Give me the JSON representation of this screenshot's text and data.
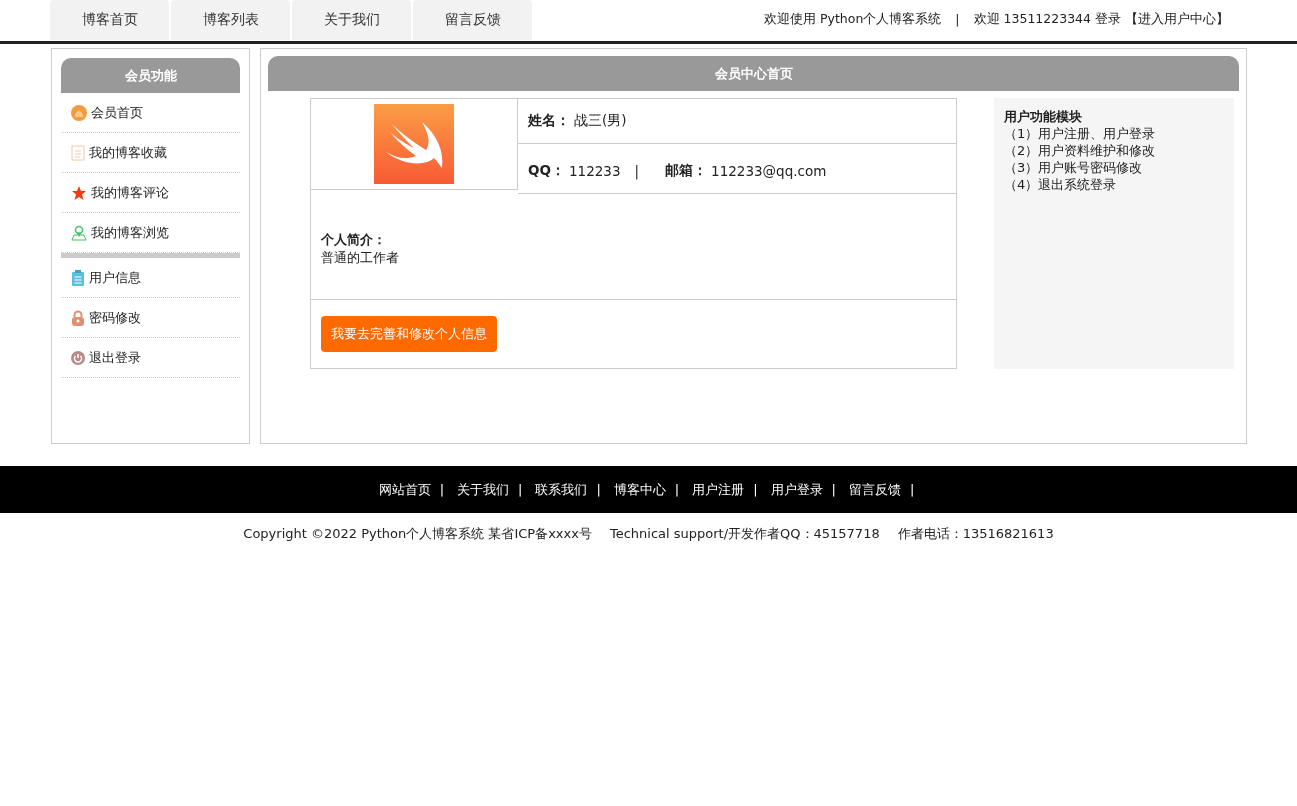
{
  "nav": {
    "tabs": [
      {
        "label": "博客首页"
      },
      {
        "label": "博客列表"
      },
      {
        "label": "关于我们"
      },
      {
        "label": "留言反馈"
      }
    ],
    "welcome": "欢迎使用 Python个人博客系统",
    "separator": "|",
    "user": "欢迎 13511223344 登录",
    "center_link": "【进入用户中心】"
  },
  "sidebar": {
    "title": "会员功能",
    "groups": [
      [
        {
          "label": "会员首页",
          "kind": "home"
        },
        {
          "label": "我的博客收藏",
          "kind": "doc"
        },
        {
          "label": "我的博客评论",
          "kind": "star"
        },
        {
          "label": "我的博客浏览",
          "kind": "pin"
        }
      ],
      [
        {
          "label": "用户信息",
          "kind": "clipboard"
        },
        {
          "label": "密码修改",
          "kind": "lock"
        },
        {
          "label": "退出登录",
          "kind": "power"
        }
      ]
    ]
  },
  "main": {
    "title": "会员中心首页",
    "profile": {
      "name_label": "姓名：",
      "name": "战三(男)",
      "qq_label": "QQ：",
      "qq": "112233",
      "separator": "|",
      "email_label": "邮箱：",
      "email": "112233@qq.com",
      "intro_label": "个人简介：",
      "intro": "普通的工作者",
      "edit_button": "我要去完善和修改个人信息"
    },
    "module": {
      "title": "用户功能模块",
      "items": [
        "（1）用户注册、用户登录",
        "（2）用户资料维护和修改",
        "（3）用户账号密码修改",
        "（4）退出系统登录"
      ]
    }
  },
  "footer": {
    "links": [
      "网站首页",
      "关于我们",
      "联系我们",
      "博客中心",
      "用户注册",
      "用户登录",
      "留言反馈"
    ],
    "separator": "|",
    "copyright": "Copyright ©2022 Python个人博客系统 某省ICP备xxxx号",
    "support": "Technical support/开发作者QQ：45157718",
    "phone": "作者电话：13516821613"
  }
}
